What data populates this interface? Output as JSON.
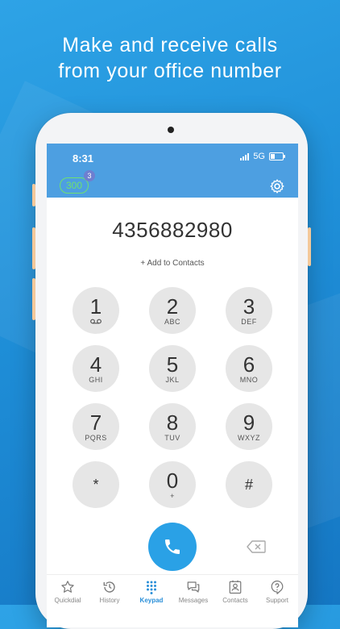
{
  "headline": [
    "Make and receive calls",
    "from your office number"
  ],
  "status": {
    "time": "8:31",
    "network": "5G"
  },
  "app": {
    "extension": "300",
    "notification_count": "3",
    "dialed_number": "4356882980",
    "add_contact_label": "+ Add to Contacts"
  },
  "keypad": [
    {
      "digit": "1",
      "letters": "voicemail-icon"
    },
    {
      "digit": "2",
      "letters": "ABC"
    },
    {
      "digit": "3",
      "letters": "DEF"
    },
    {
      "digit": "4",
      "letters": "GHI"
    },
    {
      "digit": "5",
      "letters": "JKL"
    },
    {
      "digit": "6",
      "letters": "MNO"
    },
    {
      "digit": "7",
      "letters": "PQRS"
    },
    {
      "digit": "8",
      "letters": "TUV"
    },
    {
      "digit": "9",
      "letters": "WXYZ"
    },
    {
      "digit": "*",
      "letters": ""
    },
    {
      "digit": "0",
      "letters": "+"
    },
    {
      "digit": "#",
      "letters": ""
    }
  ],
  "tabs": [
    {
      "label": "Quickdial",
      "icon": "star-icon"
    },
    {
      "label": "History",
      "icon": "history-icon"
    },
    {
      "label": "Keypad",
      "icon": "keypad-icon"
    },
    {
      "label": "Messages",
      "icon": "messages-icon"
    },
    {
      "label": "Contacts",
      "icon": "contacts-icon"
    },
    {
      "label": "Support",
      "icon": "support-icon"
    }
  ],
  "active_tab": "Keypad",
  "colors": {
    "accent": "#2aa1e6",
    "ext_green": "#6fe070",
    "header_blue": "#4d9fe1"
  }
}
